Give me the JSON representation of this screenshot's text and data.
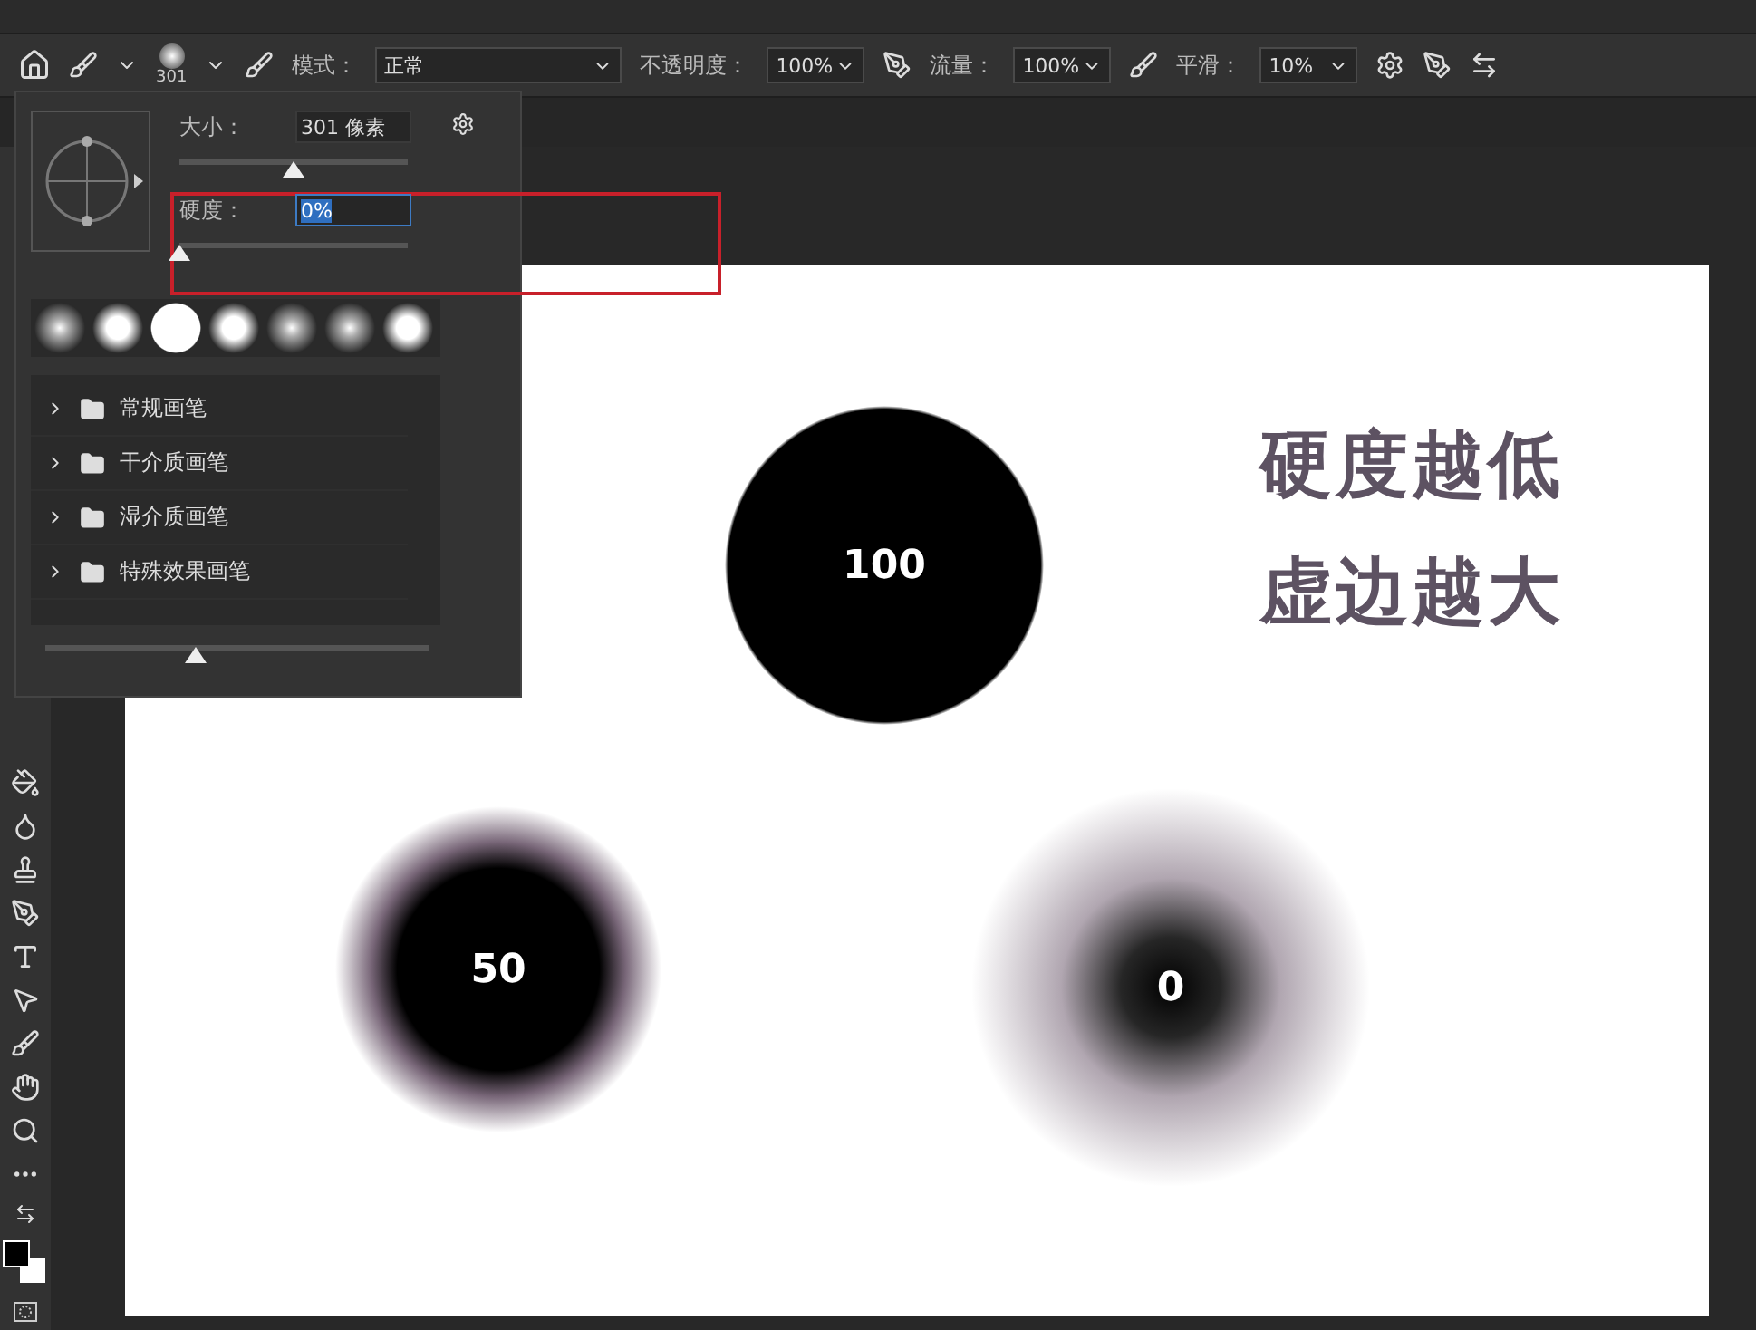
{
  "options_bar": {
    "brush_size": "301",
    "mode_label": "模式：",
    "mode_value": "正常",
    "opacity_label": "不透明度：",
    "opacity_value": "100%",
    "flow_label": "流量：",
    "flow_value": "100%",
    "smoothing_label": "平滑：",
    "smoothing_value": "10%"
  },
  "brush_panel": {
    "size_label": "大小：",
    "size_value": "301 像素",
    "size_slider": {
      "level": 0.5
    },
    "hardness_label": "硬度：",
    "hardness_value": "0%",
    "hardness_slider": {
      "level": 0
    },
    "presets": [
      {
        "kind": "soft"
      },
      {
        "kind": "medium"
      },
      {
        "kind": "hard"
      },
      {
        "kind": "medium"
      },
      {
        "kind": "soft"
      },
      {
        "kind": "soft"
      },
      {
        "kind": "medium"
      }
    ],
    "folders": [
      {
        "label": "常规画笔",
        "expanded": false
      },
      {
        "label": "干介质画笔",
        "expanded": false
      },
      {
        "label": "湿介质画笔",
        "expanded": false
      },
      {
        "label": "特殊效果画笔",
        "expanded": false
      }
    ],
    "preview_slider": {
      "level": 0.39
    }
  },
  "canvas": {
    "circles": [
      {
        "label": "100",
        "kind": "hard"
      },
      {
        "label": "50",
        "kind": "medium"
      },
      {
        "label": "0",
        "kind": "soft"
      }
    ],
    "caption": [
      "硬度越低",
      "虚边越大"
    ]
  }
}
